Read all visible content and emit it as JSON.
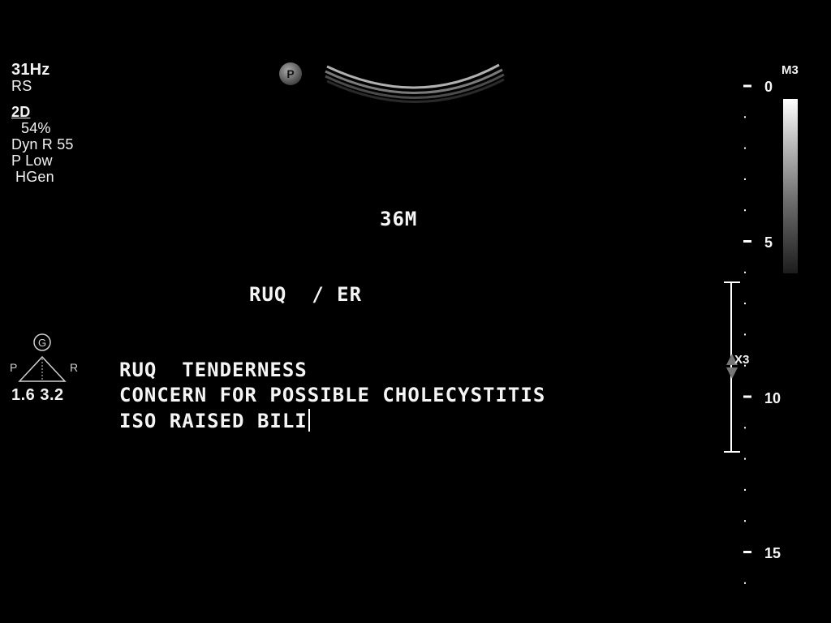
{
  "left_panel": {
    "frequency": "31Hz",
    "mode_rs": "RS",
    "mode_2d": "2D",
    "gain": "54%",
    "dyn_range": "Dyn R 55",
    "power": "P Low",
    "preset": "HGen"
  },
  "probe": {
    "marker_letter": "P"
  },
  "annotations": {
    "patient_id": "36M",
    "location": "RUQ  / ER",
    "line1": "RUQ  TENDERNESS",
    "line2": "CONCERN FOR POSSIBLE CHOLECYSTITIS",
    "line3": "ISO RAISED BILI"
  },
  "body_marker": {
    "top_letter": "G",
    "left_letter": "P",
    "right_letter": "R",
    "values": "1.6 3.2"
  },
  "depth_scale": {
    "labels": [
      "0",
      "5",
      "10",
      "15"
    ],
    "map_label": "M3",
    "focus_label": "X3"
  },
  "colors": {
    "background": "#000000",
    "text": "#f2f2f2"
  }
}
